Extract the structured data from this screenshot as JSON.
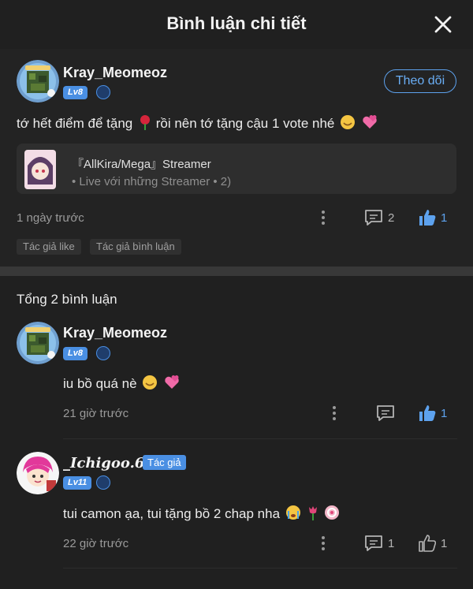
{
  "header": {
    "title": "Bình luận chi tiết",
    "close_icon": "close-icon"
  },
  "main_comment": {
    "username": "Kray_Meomeoz",
    "level": "Lv8",
    "follow_label": "Theo dõi",
    "text": "tớ hết điểm để tặng",
    "text_2": "rồi nên tớ tặng cậu 1 vote nhé",
    "link": {
      "title": "『AllKira/Mega』Streamer",
      "subtitle": "• Live với những Streamer • 2)"
    },
    "time": "1 ngày trước",
    "reply_count": "2",
    "like_count": "1",
    "tags": [
      "Tác giả like",
      "Tác giả bình luận"
    ]
  },
  "replies_header": "Tổng 2 bình luận",
  "replies": [
    {
      "username": "Kray_Meomeoz",
      "level": "Lv8",
      "text": "iu bồ quá nè",
      "time": "21 giờ trước",
      "like_count": "1"
    },
    {
      "username": "_Ichigoo.67",
      "author_badge": "Tác giả",
      "level": "Lv11",
      "text": "tui camon ạa, tui tặng bồ 2 chap nha",
      "time": "22 giờ trước",
      "reply_count": "1",
      "like_count": "1"
    }
  ],
  "colors": {
    "accent": "#5da2ee",
    "background": "#202020",
    "card": "#2e2e2e"
  }
}
